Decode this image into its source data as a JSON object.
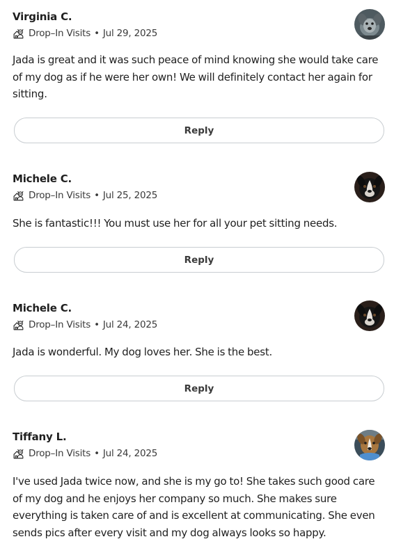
{
  "reviews": [
    {
      "name": "Virginia C.",
      "service": "Drop–In Visits",
      "separator": "•",
      "date": "Jul 29, 2025",
      "text": "Jada is great and it was such peace of mind knowing she would take care of my dog as if he were her own! We will definitely contact her again for sitting.",
      "reply_label": "Reply",
      "avatar_icon": "dog-photo-gray"
    },
    {
      "name": "Michele C.",
      "service": "Drop–In Visits",
      "separator": "•",
      "date": "Jul 25, 2025",
      "text": "She is fantastic!!! You must use her for all your pet sitting needs.",
      "reply_label": "Reply",
      "avatar_icon": "dog-photo-black-white"
    },
    {
      "name": "Michele C.",
      "service": "Drop–In Visits",
      "separator": "•",
      "date": "Jul 24, 2025",
      "text": "Jada is wonderful. My dog loves her. She is the best.",
      "reply_label": "Reply",
      "avatar_icon": "dog-photo-black-white"
    },
    {
      "name": "Tiffany L.",
      "service": "Drop–In Visits",
      "separator": "•",
      "date": "Jul 24, 2025",
      "text": "I've used Jada twice now, and she is my go to! She takes such good care of my dog and he enjoys her company so much. She makes sure everything is taken care of and is excellent at communicating. She even sends pics after every visit and my dog always looks so happy.",
      "avatar_icon": "dog-photo-tan-blue"
    }
  ]
}
